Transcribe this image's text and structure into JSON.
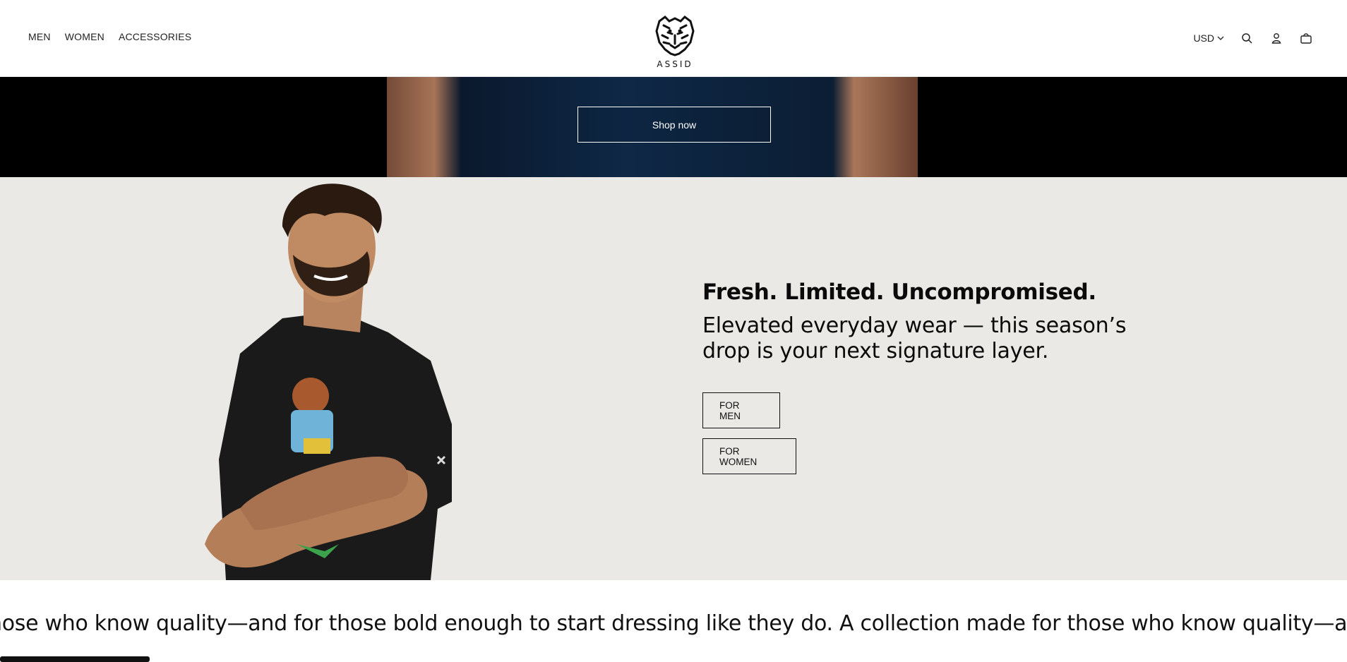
{
  "header": {
    "nav": [
      "MEN",
      "WOMEN",
      "ACCESSORIES"
    ],
    "logo_text": "ASSID",
    "currency": "USD",
    "icons": [
      "search-icon",
      "account-icon",
      "cart-icon"
    ]
  },
  "hero": {
    "cta_label": "Shop now"
  },
  "promo": {
    "title": "Fresh. Limited. Uncompromised.",
    "subtitle_line1": "Elevated everyday wear — this season’s",
    "subtitle_line2": "drop is your next signature layer.",
    "btn_men": "FOR MEN",
    "btn_women": "FOR WOMEN",
    "bg_color": "#ebe9e5"
  },
  "marquee": {
    "text": "hose who know quality—and for those bold enough to start dressing like they do.  A collection made for those who know quality—a"
  }
}
